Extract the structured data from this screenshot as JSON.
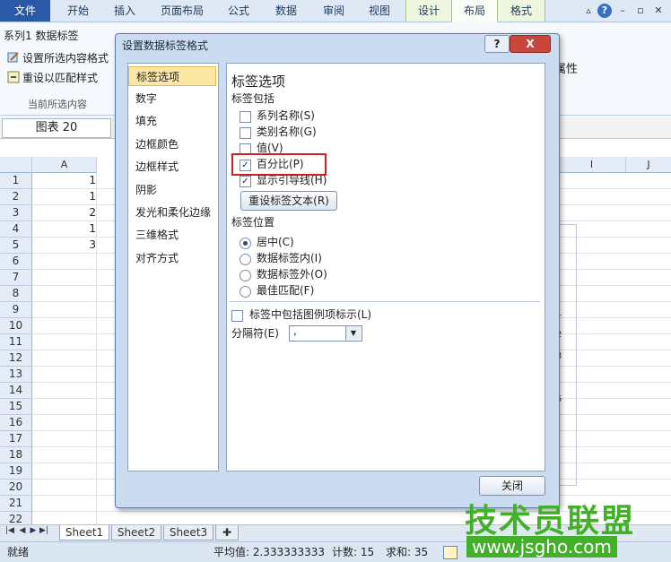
{
  "ribbon": {
    "tabs": [
      "文件",
      "开始",
      "插入",
      "页面布局",
      "公式",
      "数据",
      "审阅",
      "视图",
      "设计",
      "布局",
      "格式"
    ],
    "active_tab": "布局",
    "selection_name": "系列1 数据标签",
    "format_selection": "设置所选内容格式",
    "reset_style": "重设以匹配样式",
    "group_label": "当前所选内容",
    "partial_label": "属性"
  },
  "formula_bar": {
    "name_box": "图表 20"
  },
  "grid": {
    "columns": [
      "A",
      "I",
      "J"
    ],
    "rows": [
      "1",
      "2",
      "3",
      "4",
      "5",
      "6",
      "7",
      "8",
      "9",
      "10",
      "11",
      "12",
      "13",
      "14",
      "15",
      "16",
      "17",
      "18",
      "19",
      "20",
      "21",
      "22"
    ],
    "col_a_values": [
      "1",
      "1",
      "2",
      "1",
      "3"
    ],
    "chart_labels": [
      "1",
      "2",
      "3",
      "5"
    ]
  },
  "sheets": [
    "Sheet1",
    "Sheet2",
    "Sheet3"
  ],
  "status": {
    "ready": "就绪",
    "average": "平均值: 2.333333333",
    "count": "计数: 15",
    "sum": "求和: 35"
  },
  "dialog": {
    "title": "设置数据标签格式",
    "help": "?",
    "close_x": "X",
    "categories": [
      "标签选项",
      "数字",
      "填充",
      "边框颜色",
      "边框样式",
      "阴影",
      "发光和柔化边缘",
      "三维格式",
      "对齐方式"
    ],
    "selected_category": "标签选项",
    "heading": "标签选项",
    "contains_label": "标签包括",
    "checks": [
      {
        "label": "系列名称(S)",
        "checked": false
      },
      {
        "label": "类别名称(G)",
        "checked": false
      },
      {
        "label": "值(V)",
        "checked": false
      },
      {
        "label": "百分比(P)",
        "checked": true
      },
      {
        "label": "显示引导线(H)",
        "checked": true
      }
    ],
    "reset_text_button": "重设标签文本(R)",
    "position_label": "标签位置",
    "positions": [
      {
        "label": "居中(C)",
        "selected": true
      },
      {
        "label": "数据标签内(I)",
        "selected": false
      },
      {
        "label": "数据标签外(O)",
        "selected": false
      },
      {
        "label": "最佳匹配(F)",
        "selected": false
      }
    ],
    "legend_key_check": "标签中包括图例项标示(L)",
    "separator_label": "分隔符(E)",
    "separator_value": ",",
    "close_button": "关闭"
  },
  "watermark": {
    "text": "技术员联盟",
    "url": "www.jsgho.com"
  },
  "colors": {
    "file_tab": "#2a5aa7",
    "highlight": "#d51f1f",
    "watermark": "#43b02a",
    "selected_category": "#fde7a4"
  }
}
